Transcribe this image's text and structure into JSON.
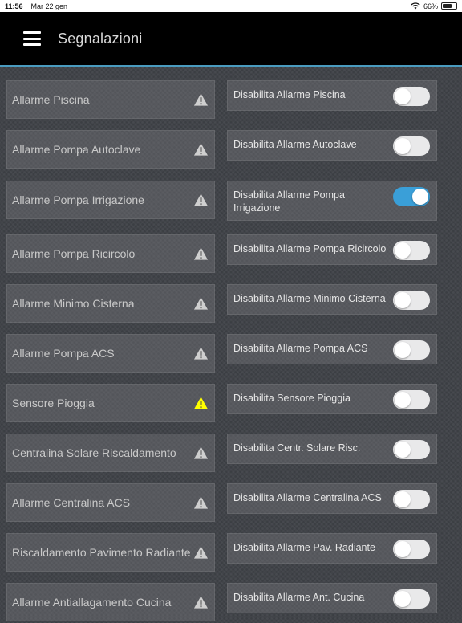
{
  "status": {
    "time": "11:56",
    "date": "Mar 22 gen",
    "battery": "66%"
  },
  "nav": {
    "title": "Segnalazioni"
  },
  "alarms": [
    {
      "label": "Allarme Piscina",
      "warn": "inactive"
    },
    {
      "label": "Allarme Pompa Autoclave",
      "warn": "inactive"
    },
    {
      "label": "Allarme Pompa Irrigazione",
      "warn": "inactive"
    },
    {
      "label": "Allarme Pompa Ricircolo",
      "warn": "inactive"
    },
    {
      "label": "Allarme Minimo Cisterna",
      "warn": "inactive"
    },
    {
      "label": "Allarme Pompa ACS",
      "warn": "inactive"
    },
    {
      "label": "Sensore Pioggia",
      "warn": "active"
    },
    {
      "label": "Centralina Solare Riscaldamento",
      "warn": "inactive"
    },
    {
      "label": "Allarme Centralina ACS",
      "warn": "inactive"
    },
    {
      "label": "Riscaldamento Pavimento Radiante",
      "warn": "inactive"
    },
    {
      "label": "Allarme Antiallagamento Cucina",
      "warn": "inactive"
    }
  ],
  "disables": [
    {
      "label": "Disabilita Allarme Piscina",
      "on": false
    },
    {
      "label": "Disabilita Allarme Autoclave",
      "on": false
    },
    {
      "label": "Disabilita Allarme Pompa Irrigazione",
      "on": true
    },
    {
      "label": "Disabilita Allarme Pompa Ricircolo",
      "on": false
    },
    {
      "label": "Disabilita Allarme Minimo Cisterna",
      "on": false
    },
    {
      "label": "Disabilita Allarme Pompa ACS",
      "on": false
    },
    {
      "label": "Disabilita Sensore Pioggia",
      "on": false
    },
    {
      "label": "Disabilita Centr. Solare Risc.",
      "on": false
    },
    {
      "label": "Disabilita Allarme Centralina ACS",
      "on": false
    },
    {
      "label": "Disabilita Allarme Pav. Radiante",
      "on": false
    },
    {
      "label": "Disabilita Allarme Ant. Cucina",
      "on": false
    }
  ],
  "colors": {
    "accent": "#3a9fd8",
    "warn_active": "#ffff00",
    "warn_inactive": "#cfcfcf",
    "nav_border": "#4a9bbf"
  }
}
